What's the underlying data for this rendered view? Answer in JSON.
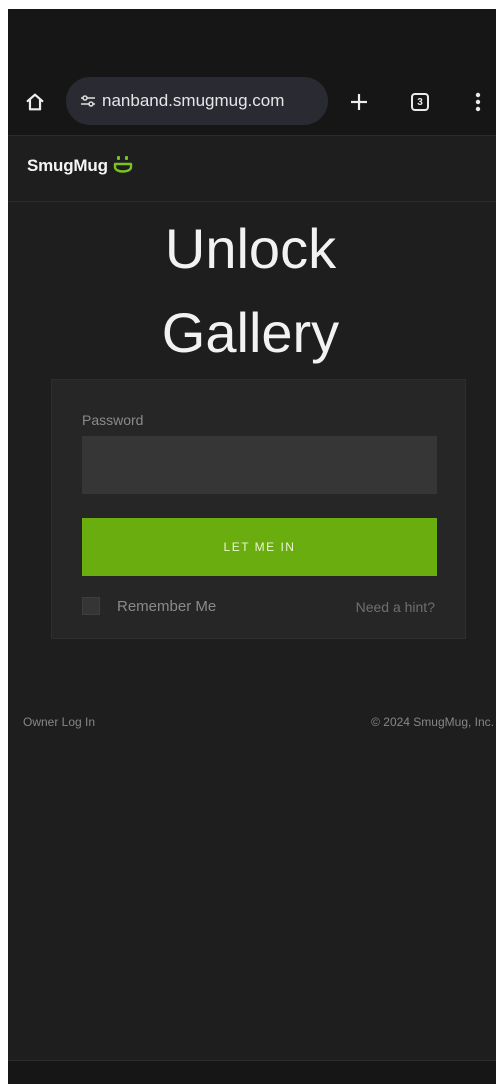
{
  "browser": {
    "url": "nanband.smugmug.com",
    "tab_count": "3"
  },
  "header": {
    "logo_text": "SmugMug"
  },
  "main": {
    "title_line1": "Unlock",
    "title_line2": "Gallery",
    "password_label": "Password",
    "password_value": "",
    "submit_label": "LET ME IN",
    "remember_label": "Remember Me",
    "remember_checked": false,
    "hint_link": "Need a hint?"
  },
  "footer": {
    "owner_login": "Owner Log In",
    "copyright": "© 2024 SmugMug, Inc."
  },
  "colors": {
    "accent": "#6aad0e",
    "background": "#1e1e1e",
    "card": "#262626"
  },
  "icons": [
    "home-icon",
    "tune-icon",
    "plus-icon",
    "tab-switcher-icon",
    "more-vert-icon",
    "smugmug-logo-icon"
  ]
}
